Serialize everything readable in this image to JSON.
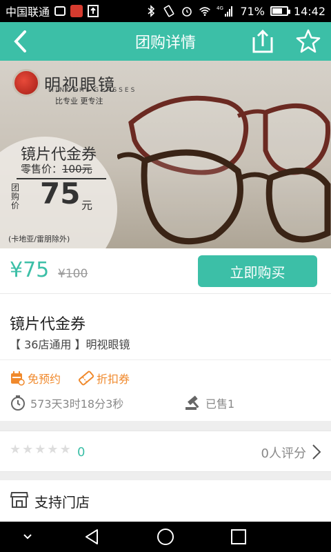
{
  "status_bar": {
    "carrier": "中国联通",
    "battery": "71%",
    "battery_level": 0.71,
    "time": "14:42",
    "network": "4G"
  },
  "header": {
    "title": "团购详情"
  },
  "banner": {
    "brand_name": "明视眼镜",
    "brand_english": "MINGSHI GLASSES",
    "brand_slogan": "比专业  更专注",
    "voucher_title": "镜片代金券",
    "retail_label": "零售价：",
    "retail_price": "100元",
    "group_label": "团购价",
    "group_price": "75",
    "group_unit": "元",
    "note": "(卡地亚/雷朋除外)"
  },
  "price_bar": {
    "current_price": "¥75",
    "original_price": "¥100",
    "buy_label": "立即购买"
  },
  "deal": {
    "title": "镜片代金券",
    "subtitle": "【 36店通用 】明视眼镜"
  },
  "tags": [
    {
      "label": "免预约",
      "icon": "calendar-icon"
    },
    {
      "label": "折扣券",
      "icon": "ticket-icon"
    }
  ],
  "meta": {
    "time_left": "573天3时18分3秒",
    "sold": "已售1"
  },
  "rating": {
    "score": "0",
    "stars_filled": 0,
    "stars_total": 5,
    "count_text": "0人评分"
  },
  "stores": {
    "label": "支持门店"
  },
  "colors": {
    "accent": "#3cbfa7",
    "tag_orange": "#f0892c"
  }
}
